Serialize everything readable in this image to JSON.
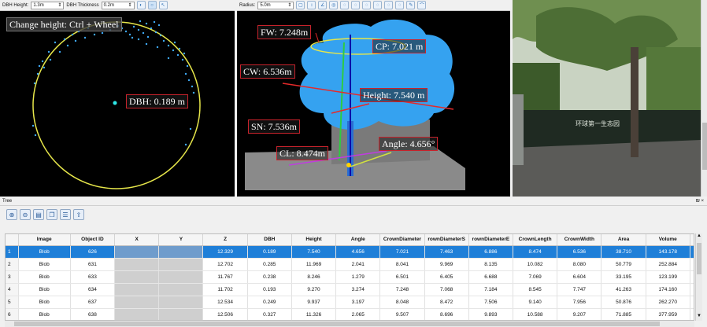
{
  "left_toolbar": {
    "dbh_height_label": "DBH Height:",
    "dbh_height_value": "1.3m",
    "dbh_thickness_label": "DBH Thickness",
    "dbh_thickness_value": "0.2m"
  },
  "mid_toolbar": {
    "radius_label": "Radius:",
    "radius_value": "5.0m"
  },
  "left_viewer": {
    "hint": "Change height: Ctrl + Wheel",
    "dbh_label": "DBH: 0.189 m"
  },
  "mid_viewer": {
    "fw": "FW: 7.248m",
    "cp": "CP: 7.021 m",
    "cw": "CW: 6.536m",
    "height": "Height: 7.540 m",
    "sn": "SN: 7.536m",
    "cl": "CL: 8.474m",
    "angle": "Angle: 4.656°"
  },
  "photo": {
    "sign": "环球第一生态园"
  },
  "panel": {
    "title": "Tree",
    "pin": "₪ ×"
  },
  "table": {
    "headers": [
      "",
      "Image",
      "Object ID",
      "X",
      "Y",
      "Z",
      "DBH",
      "Height",
      "Angle",
      "CrownDiameter",
      "rownDiameterS",
      "rownDiameterE",
      "CrownLength",
      "CrownWidth",
      "Area",
      "Volume",
      "El"
    ],
    "rows": [
      [
        "1",
        "Blob",
        "626",
        "",
        "",
        "12.329",
        "0.189",
        "7.540",
        "4.656",
        "7.021",
        "7.463",
        "6.886",
        "8.474",
        "6.536",
        "38.710",
        "143.178",
        ""
      ],
      [
        "2",
        "Blob",
        "631",
        "",
        "",
        "12.702",
        "0.285",
        "11.969",
        "2.041",
        "8.041",
        "9.969",
        "8.135",
        "10.082",
        "8.080",
        "50.779",
        "252.884",
        ""
      ],
      [
        "3",
        "Blob",
        "633",
        "",
        "",
        "11.767",
        "0.238",
        "8.246",
        "1.279",
        "6.501",
        "6.405",
        "6.688",
        "7.069",
        "6.604",
        "33.195",
        "123.199",
        ""
      ],
      [
        "4",
        "Blob",
        "634",
        "",
        "",
        "11.702",
        "0.193",
        "9.270",
        "3.274",
        "7.248",
        "7.068",
        "7.184",
        "8.545",
        "7.747",
        "41.263",
        "174.160",
        ""
      ],
      [
        "5",
        "Blob",
        "637",
        "",
        "",
        "12.534",
        "0.249",
        "9.937",
        "3.197",
        "8.048",
        "8.472",
        "7.506",
        "9.140",
        "7.956",
        "50.876",
        "262.270",
        ""
      ],
      [
        "6",
        "Blob",
        "638",
        "",
        "",
        "12.506",
        "0.327",
        "11.326",
        "2.065",
        "9.507",
        "8.696",
        "9.893",
        "10.588",
        "9.207",
        "71.885",
        "377.959",
        ""
      ]
    ]
  }
}
